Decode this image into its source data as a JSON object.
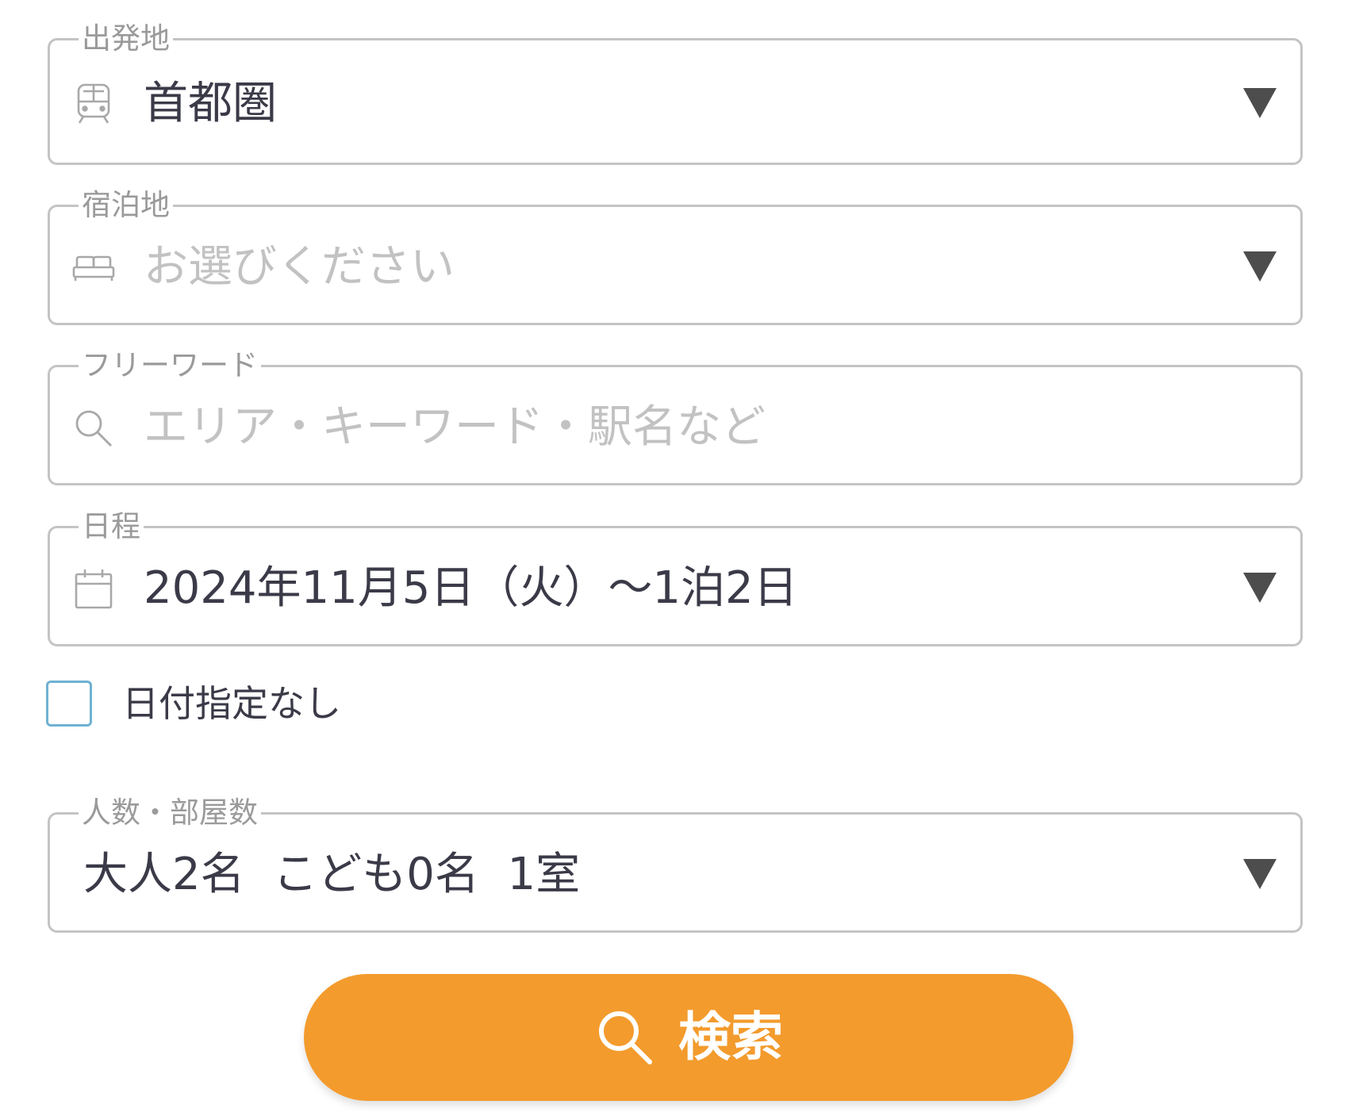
{
  "departure": {
    "label": "出発地",
    "value": "首都圏",
    "icon": "train-icon"
  },
  "lodging": {
    "label": "宿泊地",
    "placeholder": "お選びください",
    "icon": "bed-icon"
  },
  "freeword": {
    "label": "フリーワード",
    "placeholder": "エリア・キーワード・駅名など",
    "icon": "search-icon"
  },
  "schedule": {
    "label": "日程",
    "value": "2024年11月5日（火）〜1泊2日",
    "icon": "calendar-icon"
  },
  "no_date": {
    "label": "日付指定なし",
    "checked": false
  },
  "guests": {
    "label": "人数・部屋数",
    "value": "大人2名  こども0名  1室"
  },
  "search_button": {
    "label": "検索",
    "color": "#f39b2d",
    "icon": "search-icon"
  },
  "colors": {
    "border": "#c4c4c4",
    "label": "#9a9a9a",
    "placeholder": "#c2c2c2",
    "checkbox_border": "#6fb2d3",
    "arrow": "#4d4d4d"
  }
}
